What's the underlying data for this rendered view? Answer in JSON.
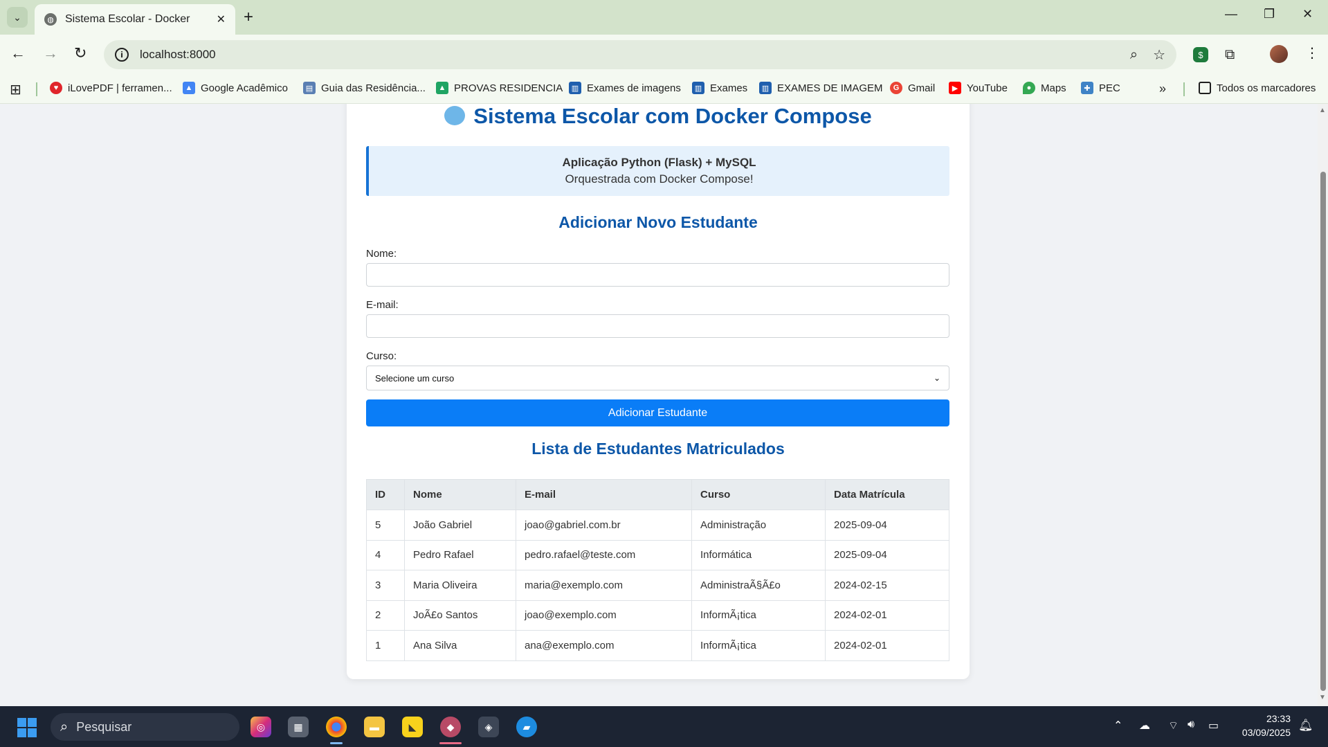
{
  "browser": {
    "tab_title": "Sistema Escolar - Docker",
    "url": "localhost:8000",
    "bookmarks": [
      {
        "label": "iLovePDF | ferramen...",
        "icon": "heart-icon",
        "color": "#e0252b"
      },
      {
        "label": "Google Acadêmico",
        "icon": "scholar-icon",
        "color": "#4285f4"
      },
      {
        "label": "Guia das Residência...",
        "icon": "book-icon",
        "color": "#5a7fb3"
      },
      {
        "label": "PROVAS RESIDENCIA",
        "icon": "drive-icon",
        "color": "#1fa463"
      },
      {
        "label": "Exames de imagens",
        "icon": "trello-icon",
        "color": "#1f5fae"
      },
      {
        "label": "Exames",
        "icon": "trello-icon",
        "color": "#1f5fae"
      },
      {
        "label": "EXAMES DE IMAGEM",
        "icon": "trello-icon",
        "color": "#1f5fae"
      },
      {
        "label": "Gmail",
        "icon": "google-icon",
        "color": "#ea4335"
      },
      {
        "label": "YouTube",
        "icon": "youtube-icon",
        "color": "#ff0000"
      },
      {
        "label": "Maps",
        "icon": "maps-icon",
        "color": "#34a853"
      },
      {
        "label": "PEC",
        "icon": "pec-icon",
        "color": "#3f83c6"
      }
    ],
    "more_bookmarks": "»",
    "all_bookmarks": "Todos os marcadores"
  },
  "page": {
    "title": "Sistema Escolar com Docker Compose",
    "info_line1": "Aplicação Python (Flask) + MySQL",
    "info_line2": "Orquestrada com Docker Compose!",
    "form": {
      "section_title": "Adicionar Novo Estudante",
      "name_label": "Nome:",
      "name_value": "",
      "email_label": "E-mail:",
      "email_value": "",
      "course_label": "Curso:",
      "course_selected": "Selecione um curso",
      "submit_label": "Adicionar Estudante"
    },
    "list": {
      "section_title": "Lista de Estudantes Matriculados",
      "columns": [
        "ID",
        "Nome",
        "E-mail",
        "Curso",
        "Data Matrícula"
      ],
      "rows": [
        [
          "5",
          "João Gabriel",
          "joao@gabriel.com.br",
          "Administração",
          "2025-09-04"
        ],
        [
          "4",
          "Pedro Rafael",
          "pedro.rafael@teste.com",
          "Informática",
          "2025-09-04"
        ],
        [
          "3",
          "Maria Oliveira",
          "maria@exemplo.com",
          "AdministraÃ§Ã£o",
          "2024-02-15"
        ],
        [
          "2",
          "JoÃ£o Santos",
          "joao@exemplo.com",
          "InformÃ¡tica",
          "2024-02-01"
        ],
        [
          "1",
          "Ana Silva",
          "ana@exemplo.com",
          "InformÃ¡tica",
          "2024-02-01"
        ]
      ]
    }
  },
  "taskbar": {
    "search_placeholder": "Pesquisar",
    "time": "23:33",
    "date": "03/09/2025"
  },
  "colors": {
    "accent": "#0a7df7",
    "heading": "#0d57a8",
    "info_bg": "#e5f1fc"
  }
}
